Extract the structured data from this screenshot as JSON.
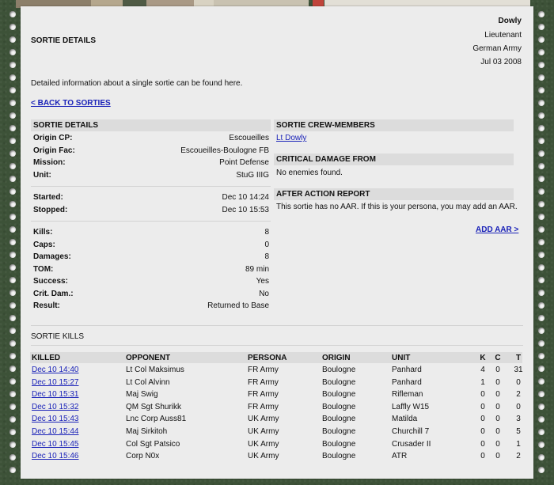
{
  "user": {
    "name": "Dowly",
    "rank": "Lieutenant",
    "army": "German Army",
    "date": "Jul 03 2008"
  },
  "page": {
    "title": "SORTIE DETAILS",
    "description": "Detailed information about a single sortie can be found here.",
    "back_link": "< BACK TO SORTIES"
  },
  "details": {
    "header": "SORTIE DETAILS",
    "group1": [
      {
        "label": "Origin CP:",
        "value": "Escoueilles"
      },
      {
        "label": "Origin Fac:",
        "value": "Escoueilles-Boulogne FB"
      },
      {
        "label": "Mission:",
        "value": "Point Defense"
      },
      {
        "label": "Unit:",
        "value": "StuG IIIG"
      }
    ],
    "group2": [
      {
        "label": "Started:",
        "value": "Dec 10 14:24"
      },
      {
        "label": "Stopped:",
        "value": "Dec 10 15:53"
      }
    ],
    "group3": [
      {
        "label": "Kills:",
        "value": "8"
      },
      {
        "label": "Caps:",
        "value": "0"
      },
      {
        "label": "Damages:",
        "value": "8"
      },
      {
        "label": "TOM:",
        "value": "89 min"
      },
      {
        "label": "Success:",
        "value": "Yes"
      },
      {
        "label": "Crit. Dam.:",
        "value": "No"
      },
      {
        "label": "Result:",
        "value": "Returned to Base"
      }
    ]
  },
  "crew": {
    "header": "SORTIE CREW-MEMBERS",
    "members": [
      "Lt Dowly"
    ]
  },
  "damage": {
    "header": "CRITICAL DAMAGE FROM",
    "text": "No enemies found."
  },
  "aar": {
    "header": "AFTER ACTION REPORT",
    "text": "This sortie has no AAR. If this is your persona, you may add an AAR.",
    "add_link": "ADD AAR >"
  },
  "kills": {
    "title": "SORTIE KILLS",
    "columns": [
      "KILLED",
      "OPPONENT",
      "PERSONA",
      "ORIGIN",
      "UNIT",
      "K",
      "C",
      "T"
    ],
    "rows": [
      {
        "killed": "Dec 10 14:40",
        "opponent": "Lt Col Maksimus",
        "persona": "FR Army",
        "origin": "Boulogne",
        "unit": "Panhard",
        "k": "4",
        "c": "0",
        "t": "31"
      },
      {
        "killed": "Dec 10 15:27",
        "opponent": "Lt Col Alvinn",
        "persona": "FR Army",
        "origin": "Boulogne",
        "unit": "Panhard",
        "k": "1",
        "c": "0",
        "t": "0"
      },
      {
        "killed": "Dec 10 15:31",
        "opponent": "Maj Swig",
        "persona": "FR Army",
        "origin": "Boulogne",
        "unit": "Rifleman",
        "k": "0",
        "c": "0",
        "t": "2"
      },
      {
        "killed": "Dec 10 15:32",
        "opponent": "QM Sgt Shurikk",
        "persona": "FR Army",
        "origin": "Boulogne",
        "unit": "Laffly W15",
        "k": "0",
        "c": "0",
        "t": "0"
      },
      {
        "killed": "Dec 10 15:43",
        "opponent": "Lnc Corp Auss81",
        "persona": "UK Army",
        "origin": "Boulogne",
        "unit": "Matilda",
        "k": "0",
        "c": "0",
        "t": "3"
      },
      {
        "killed": "Dec 10 15:44",
        "opponent": "Maj Sirkitoh",
        "persona": "UK Army",
        "origin": "Boulogne",
        "unit": "Churchill 7",
        "k": "0",
        "c": "0",
        "t": "5"
      },
      {
        "killed": "Dec 10 15:45",
        "opponent": "Col Sgt Patsico",
        "persona": "UK Army",
        "origin": "Boulogne",
        "unit": "Crusader II",
        "k": "0",
        "c": "0",
        "t": "1"
      },
      {
        "killed": "Dec 10 15:46",
        "opponent": "Corp N0x",
        "persona": "UK Army",
        "origin": "Boulogne",
        "unit": "ATR",
        "k": "0",
        "c": "0",
        "t": "2"
      }
    ]
  },
  "colors": {
    "background": "#3d5238",
    "paper": "#ececec",
    "section_header": "#dcdcdc",
    "link": "#1a22b8"
  }
}
